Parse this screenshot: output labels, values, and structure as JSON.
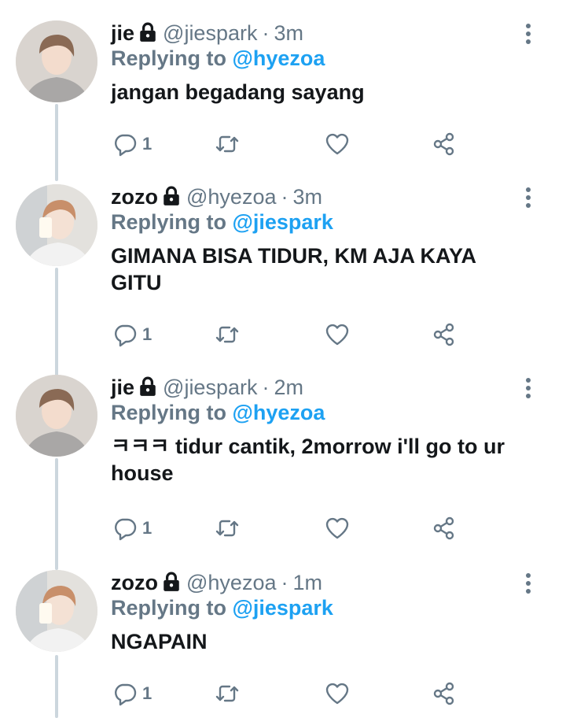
{
  "tweets": [
    {
      "name": "jie",
      "handle": "@jiespark",
      "time": "3m",
      "replying_label": "Replying to",
      "replying_to": "@hyezoa",
      "text": "jangan begadang sayang",
      "reply_count": "1",
      "avatar_icon": "avatar-jie"
    },
    {
      "name": "zozo",
      "handle": "@hyezoa",
      "time": "3m",
      "replying_label": "Replying to",
      "replying_to": "@jiespark",
      "text": "GIMANA BISA TIDUR, KM AJA KAYA GITU",
      "reply_count": "1",
      "avatar_icon": "avatar-zozo"
    },
    {
      "name": "jie",
      "handle": "@jiespark",
      "time": "2m",
      "replying_label": "Replying to",
      "replying_to": "@hyezoa",
      "text": "ㅋㅋㅋ tidur cantik, 2morrow i'll go to ur house",
      "reply_count": "1",
      "avatar_icon": "avatar-jie"
    },
    {
      "name": "zozo",
      "handle": "@hyezoa",
      "time": "1m",
      "replying_label": "Replying to",
      "replying_to": "@jiespark",
      "text": "NGAPAIN",
      "reply_count": "1",
      "avatar_icon": "avatar-zozo"
    }
  ],
  "separator": "·",
  "icons": {
    "lock": "lock-icon",
    "more": "more-icon",
    "reply": "reply-icon",
    "retweet": "retweet-icon",
    "like": "like-icon",
    "share": "share-icon"
  },
  "colors": {
    "text": "#14171a",
    "secondary": "#657786",
    "mention": "#1da1f2",
    "thread_line": "#ccd6dd"
  }
}
